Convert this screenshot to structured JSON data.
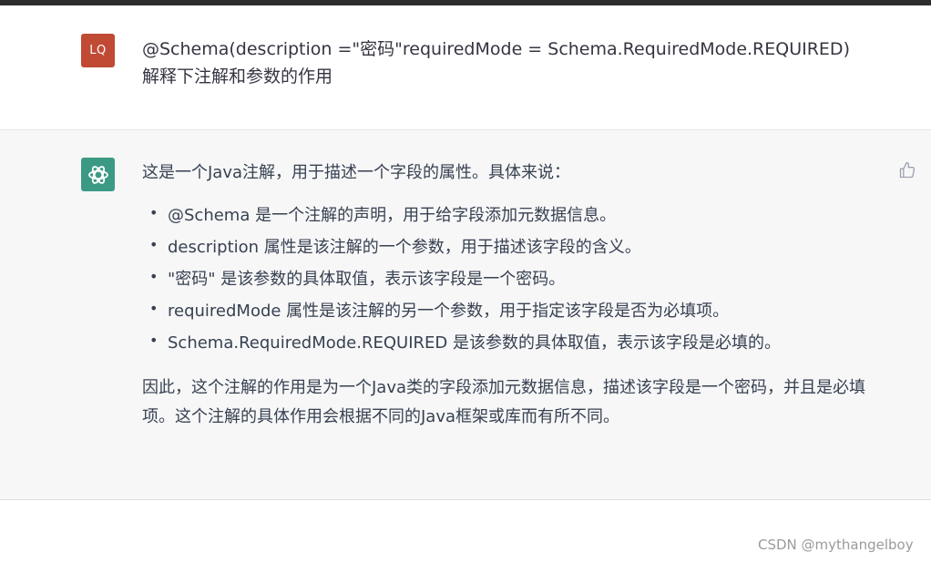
{
  "user_message": {
    "avatar_initials": "LQ",
    "lines": [
      "@Schema(description =\"密码\"requiredMode = Schema.RequiredMode.REQUIRED)",
      "解释下注解和参数的作用"
    ]
  },
  "assistant_message": {
    "intro": "这是一个Java注解，用于描述一个字段的属性。具体来说：",
    "bullets": [
      "@Schema 是一个注解的声明，用于给字段添加元数据信息。",
      "description 属性是该注解的一个参数，用于描述该字段的含义。",
      "\"密码\" 是该参数的具体取值，表示该字段是一个密码。",
      "requiredMode 属性是该注解的另一个参数，用于指定该字段是否为必填项。",
      "Schema.RequiredMode.REQUIRED 是该参数的具体取值，表示该字段是必填的。"
    ],
    "conclusion": "因此，这个注解的作用是为一个Java类的字段添加元数据信息，描述该字段是一个密码，并且是必填项。这个注解的具体作用会根据不同的Java框架或库而有所不同。"
  },
  "watermark": "CSDN @mythangelboy",
  "icons": {
    "assistant_avatar": "openai-logo-icon",
    "feedback": "thumbs-up-icon"
  },
  "colors": {
    "user_avatar_bg": "#c14a34",
    "assistant_avatar_bg": "#3c9a84",
    "assistant_row_bg": "#f7f7f8"
  }
}
